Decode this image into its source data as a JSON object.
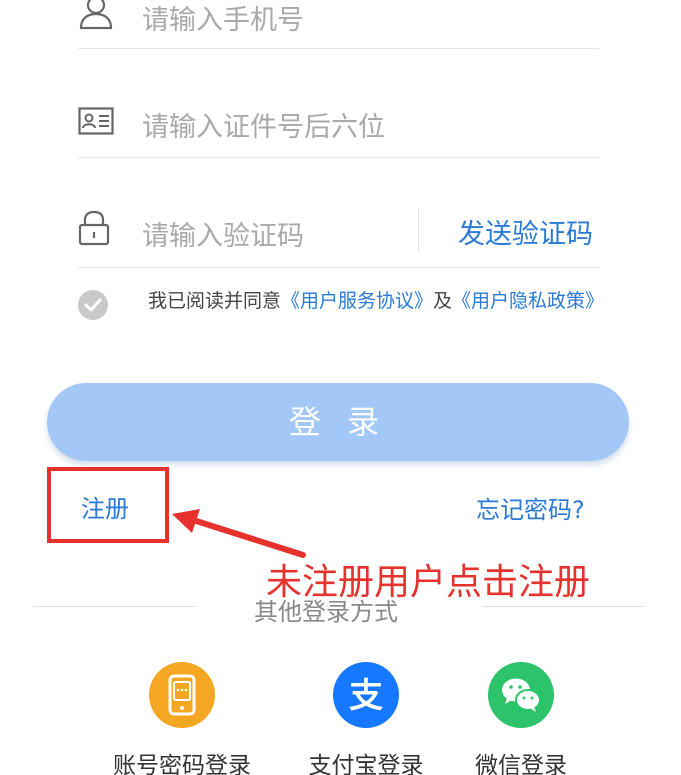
{
  "form": {
    "phone_placeholder": "请输入手机号",
    "id_placeholder": "请输入证件号后六位",
    "code_placeholder": "请输入验证码",
    "send_code_label": "发送验证码"
  },
  "agreement": {
    "prefix": "我已阅读并同意",
    "service_link": "《用户服务协议》",
    "joiner": "及",
    "privacy_link": "《用户隐私政策》"
  },
  "login_button": "登 录",
  "register_link": "注册",
  "forgot_link": "忘记密码?",
  "annotation": "未注册用户点击注册",
  "other_login": {
    "title": "其他登录方式",
    "methods": [
      {
        "label": "账号密码登录",
        "icon": "phone-icon",
        "color": "#f5a623"
      },
      {
        "label": "支付宝登录",
        "icon": "alipay-icon",
        "color": "#1677ff"
      },
      {
        "label": "微信登录",
        "icon": "wechat-icon",
        "color": "#2cc36b"
      }
    ]
  },
  "colors": {
    "accent": "#2a7ad6",
    "annotation": "#e5322d",
    "button": "#a3c8f7"
  }
}
